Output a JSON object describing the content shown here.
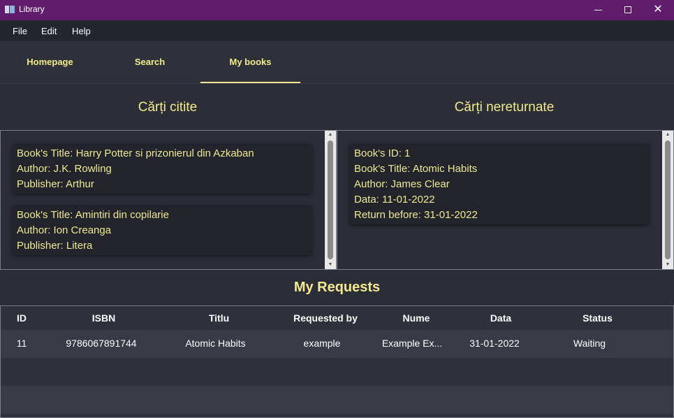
{
  "window": {
    "title": "Library",
    "title_color": "#5f1d6b"
  },
  "menu": {
    "items": [
      "File",
      "Edit",
      "Help"
    ]
  },
  "tabs": [
    {
      "label": "Homepage",
      "active": false
    },
    {
      "label": "Search",
      "active": false
    },
    {
      "label": "My books",
      "active": true
    }
  ],
  "accent_color": "#f1ea8e",
  "sections": {
    "read_title": "Cărți citite",
    "unreturned_title": "Cărți nereturnate"
  },
  "read_books": [
    {
      "title": "Book's Title: Harry Potter si prizonierul din Azkaban",
      "author": "Author: J.K. Rowling",
      "publisher": "Publisher: Arthur"
    },
    {
      "title": "Book's Title: Amintiri din copilarie",
      "author": "Author: Ion Creanga",
      "publisher": "Publisher: Litera"
    }
  ],
  "unreturned_books": [
    {
      "id": "Book's ID: 1",
      "title": "Book's Title: Atomic Habits",
      "author": "Author: James Clear",
      "date": "Data: 11-01-2022",
      "return": "Return before: 31-01-2022"
    }
  ],
  "requests": {
    "title": "My Requests",
    "columns": [
      "ID",
      "ISBN",
      "Titlu",
      "Requested by",
      "Nume",
      "Data",
      "Status"
    ],
    "rows": [
      {
        "id": "11",
        "isbn": "9786067891744",
        "titlu": "Atomic Habits",
        "requested_by": "example",
        "nume": "Example Ex...",
        "data": "31-01-2022",
        "status": "Waiting"
      }
    ]
  }
}
